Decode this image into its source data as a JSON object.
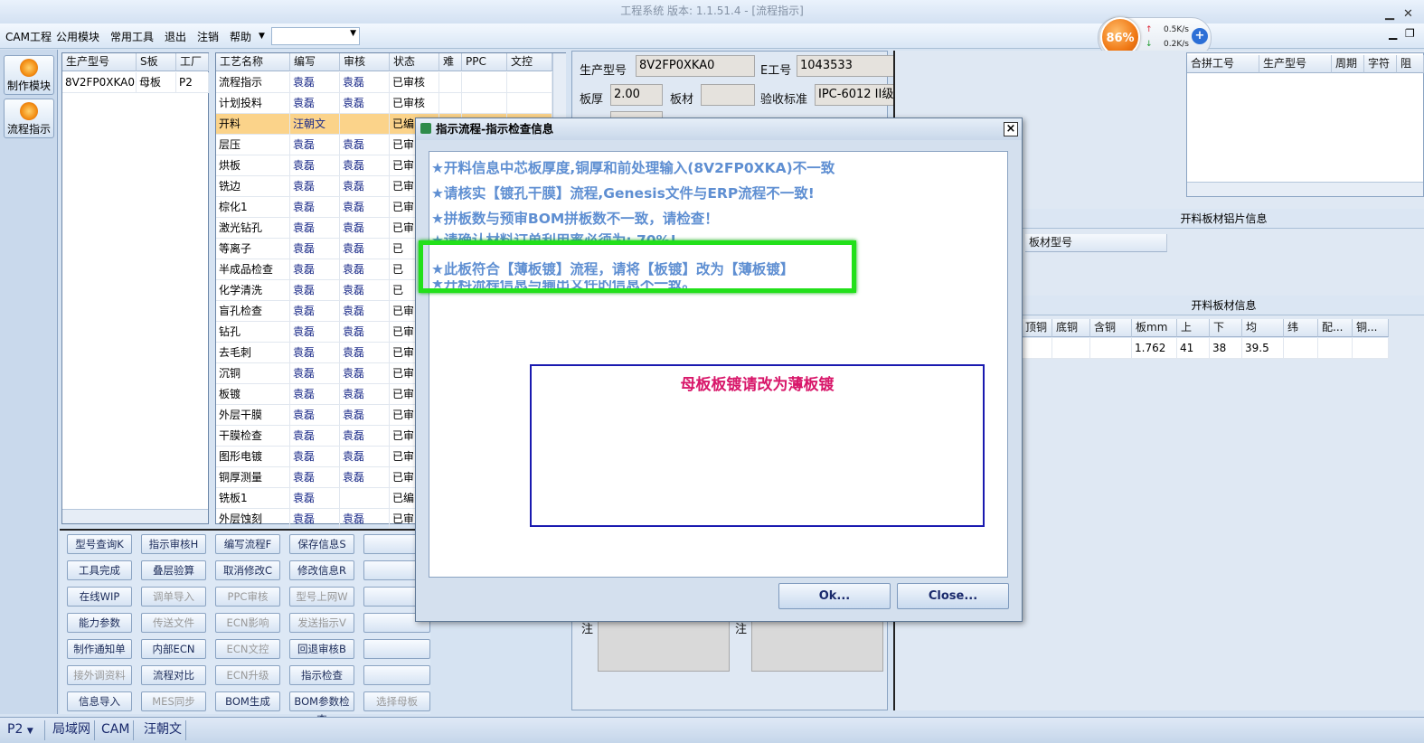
{
  "window": {
    "title": "工程系统   版本: 1.1.51.4 - [流程指示]"
  },
  "menu": {
    "items": [
      "CAM工程",
      "公用模块",
      "常用工具",
      "退出",
      "注销",
      "帮助"
    ]
  },
  "monitor": {
    "cpu": "86%",
    "up": "0.5K/s",
    "down": "0.2K/s",
    "plus": "+"
  },
  "rail": {
    "btn1": "制作模块",
    "btn2": "流程指示"
  },
  "table_a": {
    "headers": [
      "生产型号",
      "S板",
      "工厂"
    ],
    "row": [
      "8V2FP0XKA0",
      "母板",
      "P2"
    ]
  },
  "table_b": {
    "headers": [
      "工艺名称",
      "编写",
      "审核",
      "状态",
      "难",
      "PPC",
      "文控"
    ],
    "rows": [
      [
        "流程指示",
        "袁磊",
        "袁磊",
        "已审核"
      ],
      [
        "计划投料",
        "袁磊",
        "袁磊",
        "已审核"
      ],
      [
        "开料",
        "汪朝文",
        "",
        "已编"
      ],
      [
        "层压",
        "袁磊",
        "袁磊",
        "已审"
      ],
      [
        "烘板",
        "袁磊",
        "袁磊",
        "已审"
      ],
      [
        "铣边",
        "袁磊",
        "袁磊",
        "已审"
      ],
      [
        "棕化1",
        "袁磊",
        "袁磊",
        "已审"
      ],
      [
        "激光钻孔",
        "袁磊",
        "袁磊",
        "已审"
      ],
      [
        "等离子",
        "袁磊",
        "袁磊",
        "已"
      ],
      [
        "半成品检查",
        "袁磊",
        "袁磊",
        "已"
      ],
      [
        "化学清洗",
        "袁磊",
        "袁磊",
        "已"
      ],
      [
        "盲孔检查",
        "袁磊",
        "袁磊",
        "已审"
      ],
      [
        "钻孔",
        "袁磊",
        "袁磊",
        "已审"
      ],
      [
        "去毛刺",
        "袁磊",
        "袁磊",
        "已审"
      ],
      [
        "沉铜",
        "袁磊",
        "袁磊",
        "已审"
      ],
      [
        "板镀",
        "袁磊",
        "袁磊",
        "已审"
      ],
      [
        "外层干膜",
        "袁磊",
        "袁磊",
        "已审"
      ],
      [
        "干膜检查",
        "袁磊",
        "袁磊",
        "已审"
      ],
      [
        "图形电镀",
        "袁磊",
        "袁磊",
        "已审"
      ],
      [
        "铜厚测量",
        "袁磊",
        "袁磊",
        "已审"
      ],
      [
        "铣板1",
        "袁磊",
        "",
        "已编"
      ],
      [
        "外层蚀刻",
        "袁磊",
        "袁磊",
        "已审"
      ]
    ]
  },
  "buttons": {
    "r1": [
      "型号查询K",
      "指示审核H",
      "编写流程F",
      "保存信息S",
      ""
    ],
    "r2": [
      "工具完成",
      "叠层验算",
      "取消修改C",
      "修改信息R",
      ""
    ],
    "r3": [
      "在线WIP",
      "调单导入",
      "PPC审核",
      "型号上网W",
      ""
    ],
    "r4": [
      "能力参数",
      "传送文件",
      "ECN影响",
      "发送指示V",
      ""
    ],
    "r5": [
      "制作通知单",
      "内部ECN",
      "ECN文控",
      "回退审核B",
      ""
    ],
    "r6": [
      "接外调资料",
      "流程对比",
      "ECN升级",
      "指示检查",
      ""
    ],
    "r7": [
      "信息导入",
      "MES同步",
      "BOM生成",
      "BOM参数检查",
      "选择母板"
    ]
  },
  "info": {
    "model_label": "生产型号",
    "model_value": "8V2FP0XKA0",
    "e_label": "E工号",
    "e_value": "1043533",
    "thick_label": "板厚",
    "thick_value": "2.00",
    "mat_label": "板材",
    "mat_value": "",
    "std_label": "验收标准",
    "std_value": "IPC-6012 II级",
    "note1": "注",
    "note2": "注"
  },
  "right": {
    "table_c_headers": [
      "合拼工号",
      "生产型号",
      "周期",
      "字符",
      "阻"
    ],
    "sec1_title": "开料板材铝片信息",
    "sec1_col": "板材型号",
    "sec2_title": "开料板材信息",
    "sec2_headers": [
      "顶铜",
      "底铜",
      "含铜mm",
      "板mm",
      "上",
      "下",
      "均",
      "纬",
      "配...",
      "铜..."
    ],
    "sec2_row": [
      "",
      "",
      "",
      "1.762",
      "41",
      "38",
      "39.5",
      "",
      "",
      ""
    ]
  },
  "status": {
    "combo": "P2",
    "tabs": [
      "局域网",
      "CAM",
      "汪朝文"
    ]
  },
  "dialog": {
    "title": "指示流程-指示检查信息",
    "close": "×",
    "messages": [
      "★开料信息中芯板厚度,铜厚和前处理输入(8V2FP0XKA)不一致",
      "★请核实【镀孔干膜】流程,Genesis文件与ERP流程不一致!",
      "★拼板数与预审BOM拼板数不一致，请检查！",
      "★请确认材料订单利用率必须为: 70%!",
      "★此板符合【薄板镀】流程，请将【板镀】改为【薄板镀】",
      "★开料流程信息与输出文件的信息不一致。"
    ],
    "note": "母板板镀请改为薄板镀",
    "ok": "Ok...",
    "cancel": "Close..."
  }
}
